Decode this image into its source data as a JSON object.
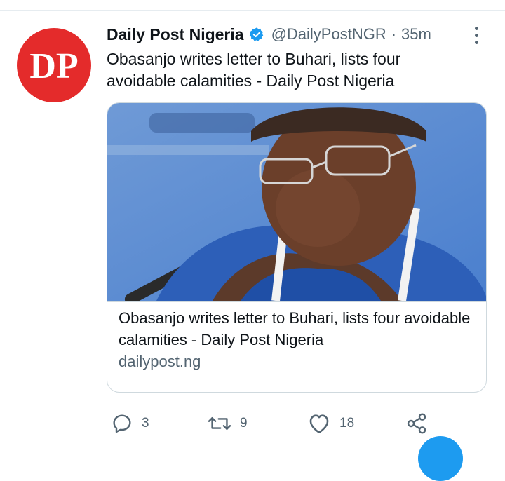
{
  "tweet": {
    "author_name": "Daily Post Nigeria",
    "handle": "@DailyPostNGR",
    "separator": "·",
    "time": "35m",
    "text": "Obasanjo writes letter to Buhari, lists four avoidable calamities - Daily Post Nigeria",
    "avatar_text": "DP"
  },
  "card": {
    "title": "Obasanjo writes letter to Buhari, lists four avoidable calamities - Daily Post Nigeria",
    "domain": "dailypost.ng",
    "image_icon": "photo-portrait-icon"
  },
  "actions": {
    "replies": "3",
    "retweets": "9",
    "likes": "18"
  },
  "colors": {
    "accent": "#1d9bf0",
    "avatar_bg": "#e42b2b",
    "muted": "#536471",
    "border": "#cfd9de"
  }
}
